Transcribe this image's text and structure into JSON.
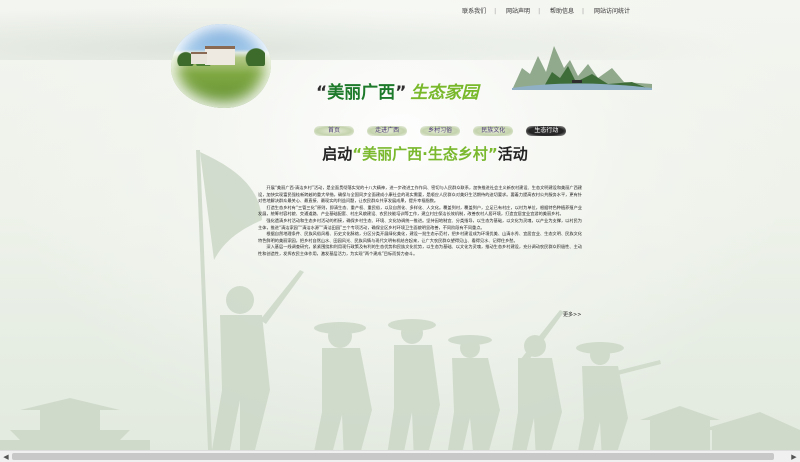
{
  "top_links": [
    "联系我们",
    "网站声明",
    "帮助信息",
    "网站访问统计"
  ],
  "banner": {
    "title_q1": "“",
    "title_main": "美丽广西",
    "title_q2": "”",
    "title_sub": "生态家园"
  },
  "nav": [
    "首页",
    "走进广西",
    "乡村习俗",
    "民族文化",
    "生态行动"
  ],
  "nav_active_index": 4,
  "section": {
    "prefix": "启动",
    "q1": "“",
    "highlight": "美丽广西·生态乡村",
    "q2": "”",
    "suffix": "活动"
  },
  "article": [
    "开展“美丽广西·清洁乡村”活动，是全面贯彻落实党的十八大精神，进一步改进工作作风、密切与人民群众联系，加快推进社会主义新农村建设、生态文明建设和美丽广西建设，加快实现富民强桂新跨越的重大举措，确保与全国同步全面建成小康社会的现实需要，是顺应人民群众对美好生活期待的迫切要求。要着力提高农村公共服务水平，更有针对性地解决群众最关心、最直接、最现实的利益问题，让农民群众共享发展成果，提升幸福指数。",
    "打造生态乡村有“三管三化”原则，即清生态、重产权、重民俗，以及自然化、多样化、人文化。覆盖到村，覆盖到户，立足已有村庄，以村为单位，根据特色种植养殖产业发展，统筹村容村貌、交通道路、产业基础配套、村庄风貌建设、农民技能培训等工作，建立村庄保洁长效机制，改善农村人居环境，打造宜居宜业宜游的美丽乡村。",
    "强化遗清乡村活动和生态乡村活动的衔接，确保乡村生态、环境、文化协调统一推进。坚持因地制宜、分类指导，以生态为基础，以文化为灵魂，以产业为支撑，以村民为主体，推进“清洁家园”“清洁水源”“清洁田园”三个专项活动，确保全区乡村环境卫生面貌明显改善，不同阶段有不同重点。",
    "根据自然地理条件、民族风俗风格、历史文化脉络，分区分类开展绿化美化，建设一批生态示范村，把乡村建设成为环境优美、山清水秀、宜居宜业、生态文明、民族文化特色鲜明的美丽家园，把乡村自然山水、田园风光、民族风情与现代文明有机结合起来，让广大农民群众望得见山、看得见水、记得住乡愁。",
    "深入基层一线调查研究，紧紧围绕和利用现行政策及有利的生态优势和民族文化优势，以生态为基础、以文化为灵魂，推动生态乡村建设，充分调动农民群众积极性、主动性和创造性，发挥农民主体作用，激发基层活力，为实现“两个建成”目标而努力奋斗。"
  ],
  "more_label": "更多>>"
}
